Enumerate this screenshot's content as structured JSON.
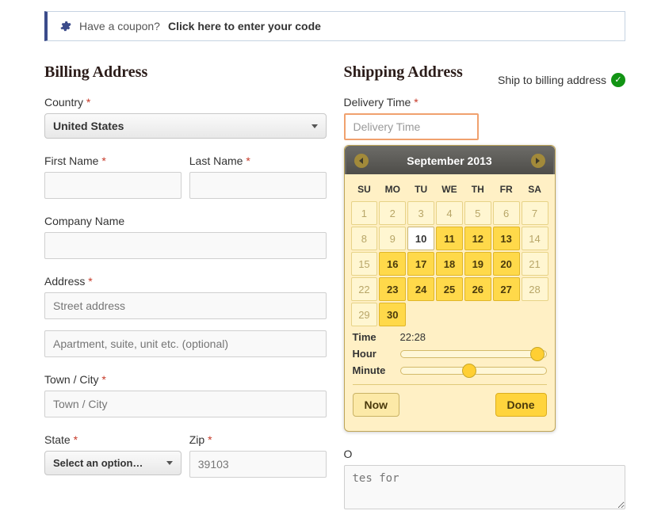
{
  "coupon": {
    "prefix": "Have a coupon?",
    "link": "Click here to enter your code"
  },
  "billing": {
    "heading": "Billing Address",
    "country": {
      "label": "Country",
      "required": "*",
      "value": "United States"
    },
    "first_name": {
      "label": "First Name",
      "required": "*"
    },
    "last_name": {
      "label": "Last Name",
      "required": "*"
    },
    "company": {
      "label": "Company Name"
    },
    "address": {
      "label": "Address",
      "required": "*",
      "placeholder1": "Street address",
      "placeholder2": "Apartment, suite, unit etc. (optional)"
    },
    "town": {
      "label": "Town / City",
      "required": "*",
      "placeholder": "Town / City"
    },
    "state": {
      "label": "State",
      "required": "*",
      "value": "Select an option…"
    },
    "zip": {
      "label": "Zip",
      "required": "*",
      "value": "39103"
    }
  },
  "shipping": {
    "heading": "Shipping Address",
    "toggle_label": "Ship to billing address",
    "delivery": {
      "label": "Delivery Time",
      "required": "*",
      "placeholder": "Delivery Time"
    },
    "order_notes": {
      "label_prefix": "O",
      "placeholder": "tes for"
    }
  },
  "datepicker": {
    "title": "September 2013",
    "dow": [
      "SU",
      "MO",
      "TU",
      "WE",
      "TH",
      "FR",
      "SA"
    ],
    "weeks": [
      [
        {
          "d": 1
        },
        {
          "d": 2
        },
        {
          "d": 3
        },
        {
          "d": 4
        },
        {
          "d": 5
        },
        {
          "d": 6
        },
        {
          "d": 7
        }
      ],
      [
        {
          "d": 8
        },
        {
          "d": 9
        },
        {
          "d": 10,
          "today": true
        },
        {
          "d": 11,
          "a": true
        },
        {
          "d": 12,
          "a": true
        },
        {
          "d": 13,
          "a": true
        },
        {
          "d": 14
        }
      ],
      [
        {
          "d": 15
        },
        {
          "d": 16,
          "a": true
        },
        {
          "d": 17,
          "a": true
        },
        {
          "d": 18,
          "a": true
        },
        {
          "d": 19,
          "a": true
        },
        {
          "d": 20,
          "a": true
        },
        {
          "d": 21
        }
      ],
      [
        {
          "d": 22
        },
        {
          "d": 23,
          "a": true
        },
        {
          "d": 24,
          "a": true
        },
        {
          "d": 25,
          "a": true
        },
        {
          "d": 26,
          "a": true
        },
        {
          "d": 27,
          "a": true
        },
        {
          "d": 28
        }
      ],
      [
        {
          "d": 29
        },
        {
          "d": 30,
          "a": true
        },
        {
          "blank": true
        },
        {
          "blank": true
        },
        {
          "blank": true
        },
        {
          "blank": true
        },
        {
          "blank": true
        }
      ]
    ],
    "time_label": "Time",
    "time_value": "22:28",
    "hour_label": "Hour",
    "minute_label": "Minute",
    "hour_pct": 94,
    "minute_pct": 47,
    "now": "Now",
    "done": "Done"
  }
}
